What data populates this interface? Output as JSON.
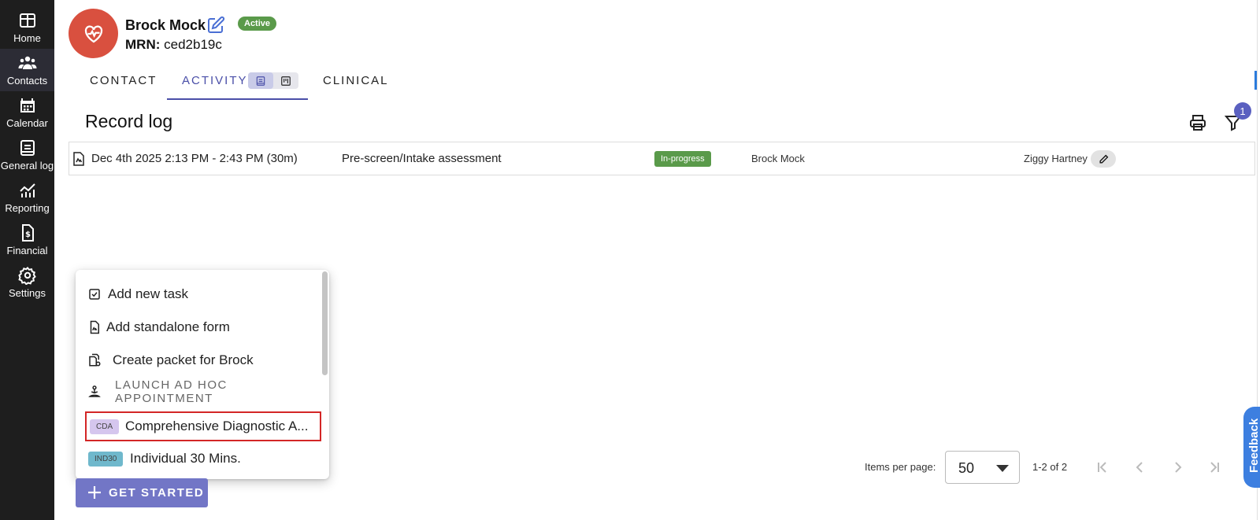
{
  "sidebar": {
    "items": [
      {
        "label": "Home",
        "icon": "home-icon"
      },
      {
        "label": "Contacts",
        "icon": "contacts-icon"
      },
      {
        "label": "Calendar",
        "icon": "calendar-icon"
      },
      {
        "label": "General log",
        "icon": "general-log-icon"
      },
      {
        "label": "Reporting",
        "icon": "reporting-icon"
      },
      {
        "label": "Financial",
        "icon": "financial-icon"
      },
      {
        "label": "Settings",
        "icon": "gear-icon"
      }
    ],
    "active": "Contacts"
  },
  "patient": {
    "name": "Brock Mock",
    "status": "Active",
    "mrn_label": "MRN:",
    "mrn_value": "ced2b19c"
  },
  "tabs": [
    {
      "label": "CONTACT"
    },
    {
      "label": "ACTIVITY",
      "active": true
    },
    {
      "label": "CLINICAL"
    }
  ],
  "record_log": {
    "title": "Record log",
    "filter_count": "1",
    "rows": [
      {
        "datetime": "Dec 4th 2025 2:13 PM - 2:43 PM (30m)",
        "type": "Pre-screen/Intake assessment",
        "status": "In-progress",
        "client": "Brock Mock",
        "provider": "Ziggy Hartney"
      }
    ]
  },
  "menu": {
    "add_task": "Add new task",
    "add_form": "Add standalone form",
    "create_packet": "Create packet for Brock",
    "adhoc_header": "LAUNCH AD HOC APPOINTMENT",
    "appointments": [
      {
        "code": "CDA",
        "name": "Comprehensive Diagnostic A...",
        "code_color": "#d5c6ee"
      },
      {
        "code": "IND30",
        "name": "Individual 30 Mins.",
        "code_color": "#6fb8cc"
      }
    ]
  },
  "get_started": {
    "label": "GET STARTED"
  },
  "pagination": {
    "items_per_page_label": "Items per page:",
    "per_page_value": "50",
    "range": "1-2 of 2"
  },
  "feedback": {
    "label": "Feedback"
  },
  "colors": {
    "sidebar_bg": "#1e1e1e",
    "accent": "#4a4fa8",
    "status_green": "#5a9a4a",
    "avatar_red": "#d9503f",
    "highlight_red": "#d32626",
    "feedback_blue": "#3d7fe0"
  }
}
